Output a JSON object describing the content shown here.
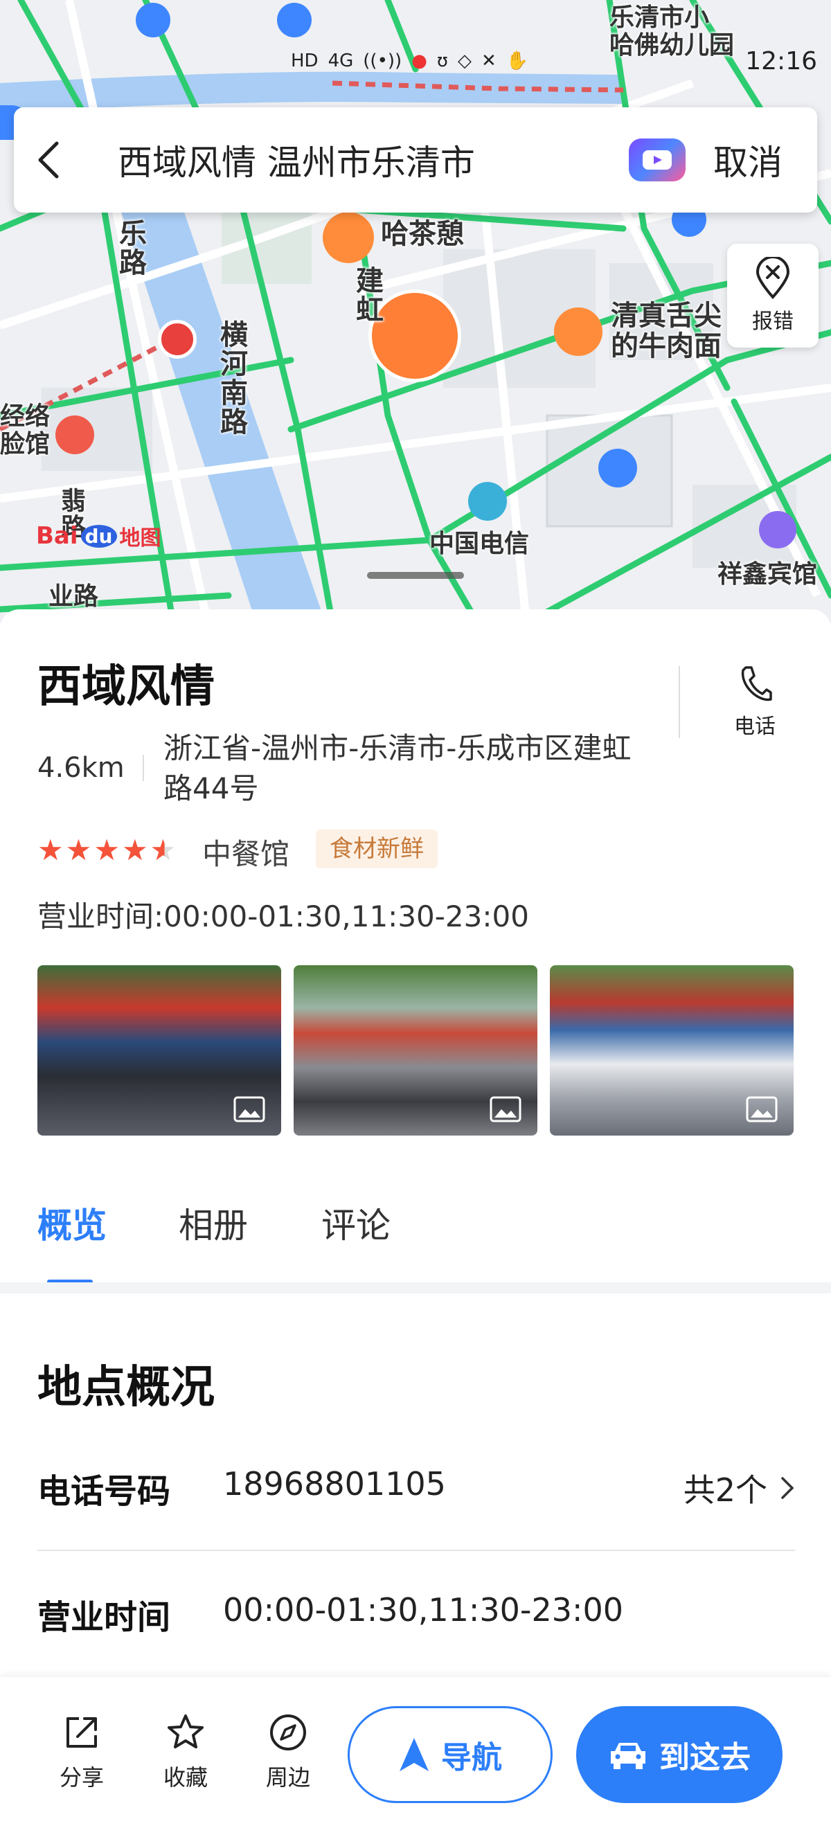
{
  "status_bar": {
    "time": "12:16",
    "icons": [
      "hd-icon",
      "signal-4g-icon",
      "wifi-icon",
      "mic-icon",
      "nfc-icon",
      "alipay-icon",
      "app-icon",
      "hand-icon"
    ]
  },
  "search": {
    "query": "西域风情 温州市乐清市",
    "cancel_label": "取消"
  },
  "map": {
    "report_label": "报错",
    "labels": {
      "kindergarten": "乐清市小 哈佛幼儿园",
      "tea_house": "哈茶憩",
      "halal": "清真舌尖 的牛肉面",
      "telecom": "中国电信",
      "hotel": "祥鑫宾馆",
      "hengyang_road": "横河南路",
      "le_road": "乐路",
      "jian_road": "建虹",
      "jingluo": "经络 脸馆",
      "fei_road": "翡路",
      "ye_road": "业路"
    },
    "brand": {
      "baidu": "Bai",
      "du": "du",
      "ditu": "地图"
    }
  },
  "place": {
    "name": "西域风情",
    "call_label": "电话",
    "distance": "4.6km",
    "address": "浙江省-温州市-乐清市-乐成市区建虹路44号",
    "rating": 4.5,
    "category": "中餐馆",
    "tag": "食材新鲜",
    "hours_line": "营业时间:00:00-01:30,11:30-23:00"
  },
  "tabs": [
    "概览",
    "相册",
    "评论"
  ],
  "overview": {
    "title": "地点概况",
    "phone_label": "电话号码",
    "phone_value": "18968801105",
    "phone_count": "共2个",
    "hours_label": "营业时间",
    "hours_value": "00:00-01:30,11:30-23:00"
  },
  "bottom_bar": {
    "share_label": "分享",
    "favorite_label": "收藏",
    "nearby_label": "周边",
    "navigate_label": "导航",
    "go_label": "到这去"
  },
  "colors": {
    "accent": "#2d7ff9",
    "road_green": "#2ecc71",
    "water": "#a9cdf5",
    "poi_orange": "#ff8c3a"
  }
}
